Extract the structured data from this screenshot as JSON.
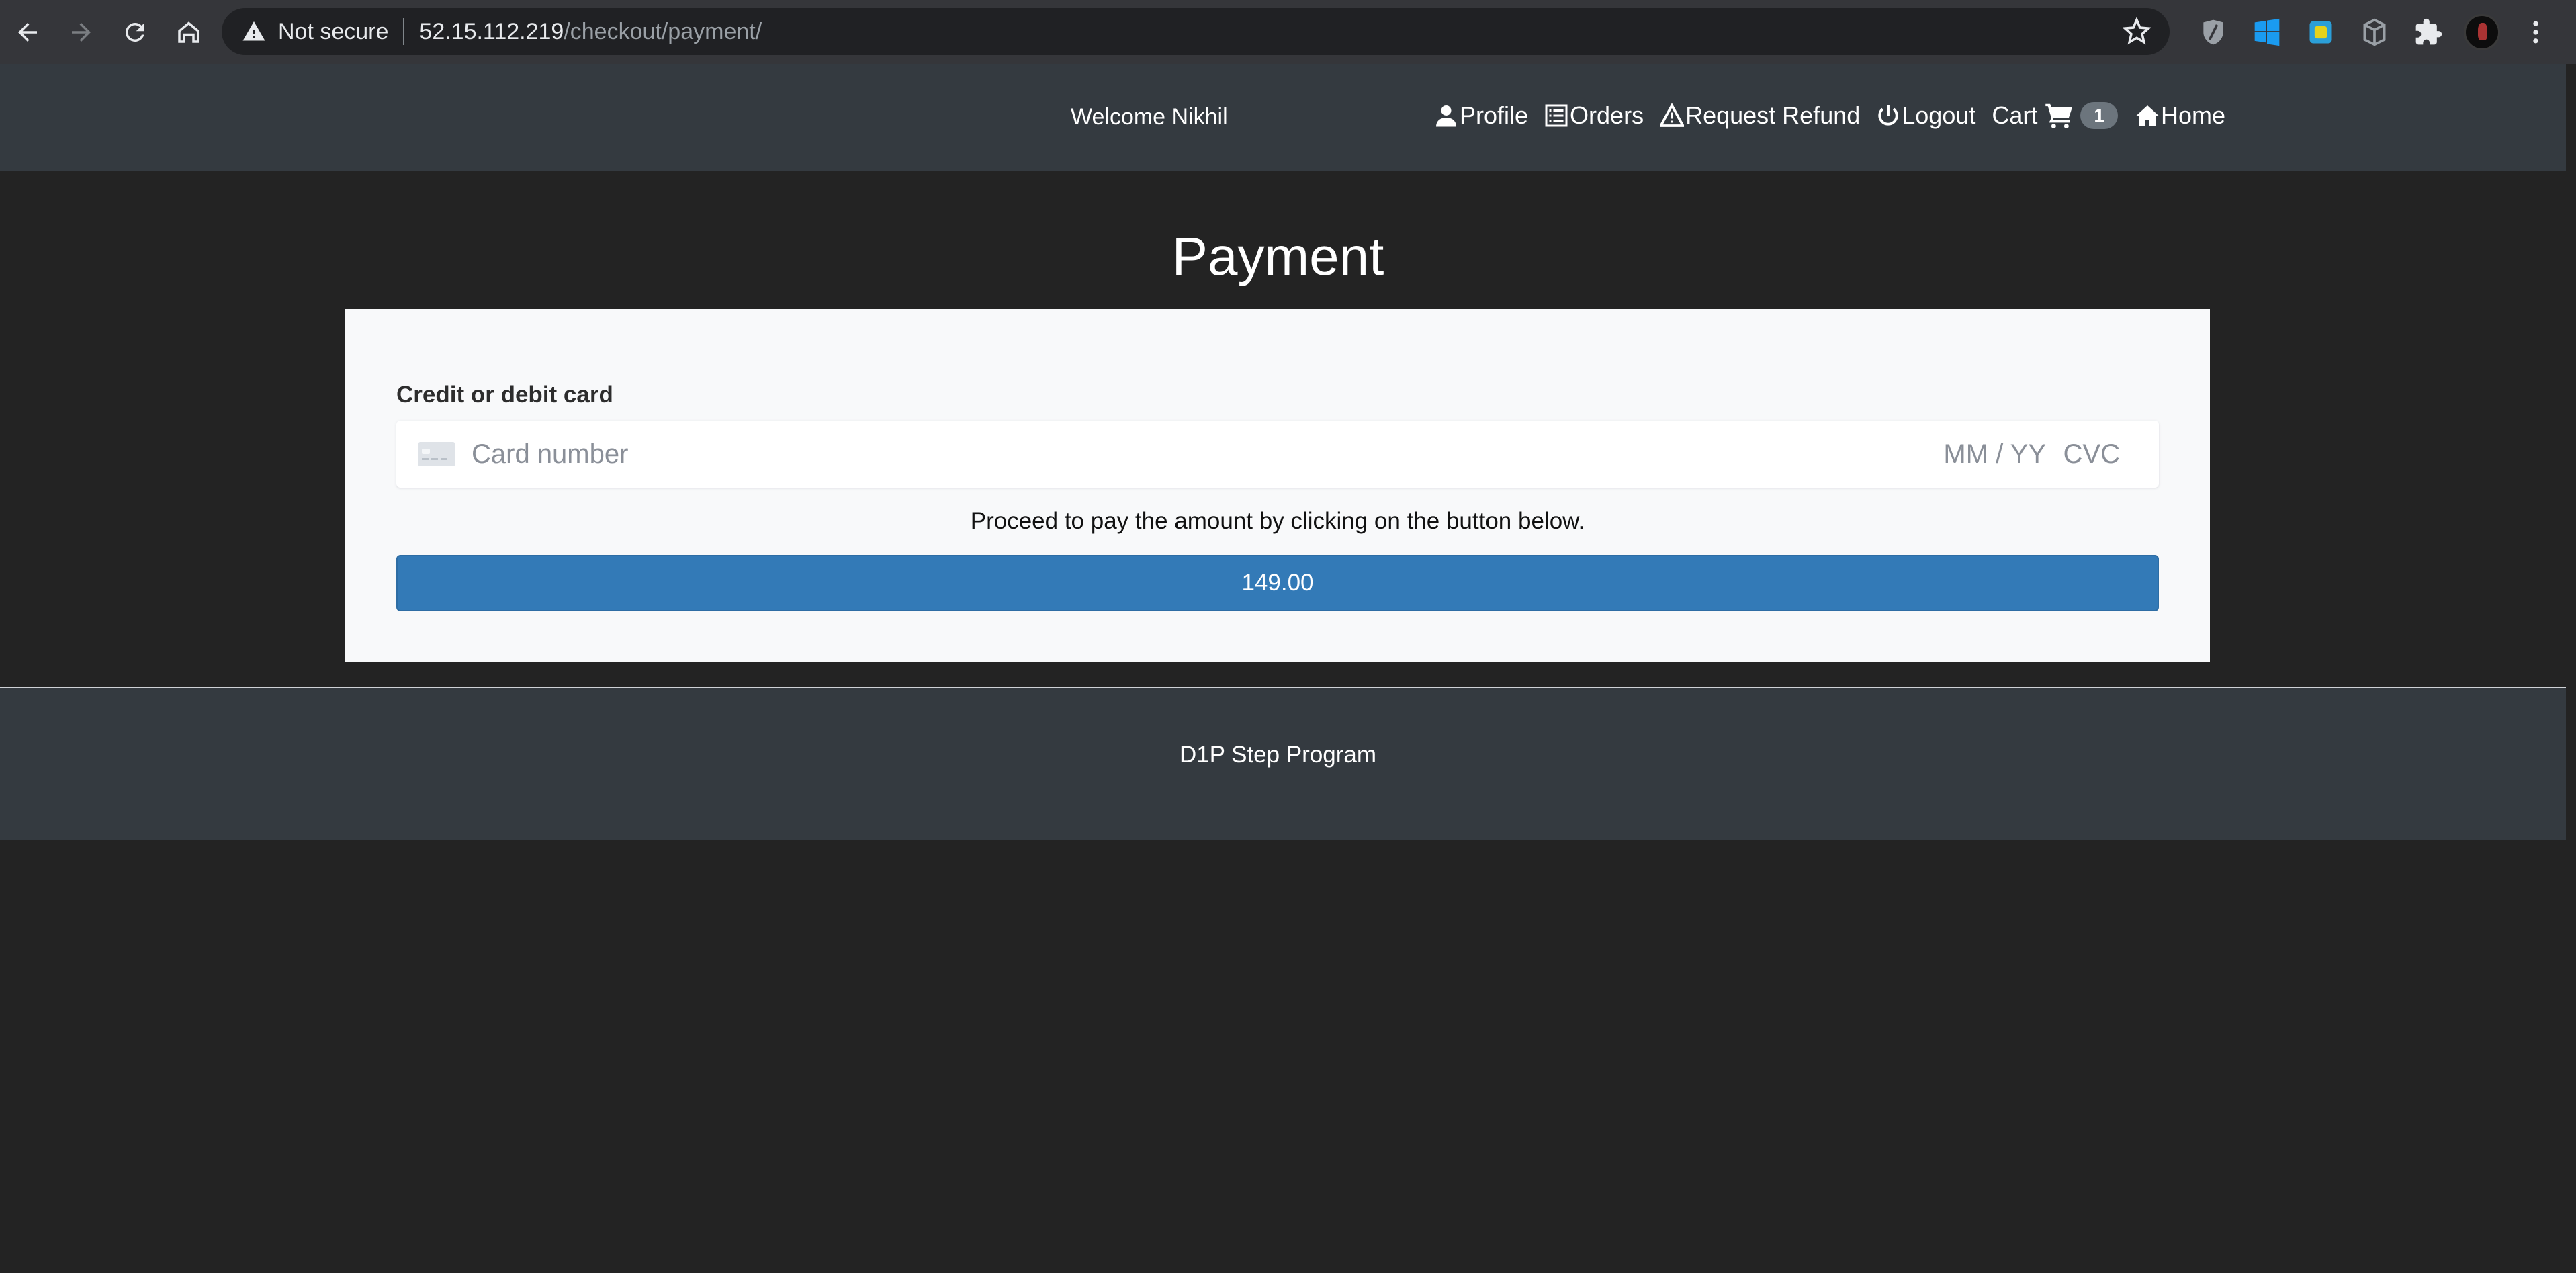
{
  "browser": {
    "security_label": "Not secure",
    "url_host": "52.15.112.219",
    "url_path": "/checkout/payment/"
  },
  "header": {
    "welcome": "Welcome Nikhil",
    "nav": {
      "profile": "Profile",
      "orders": "Orders",
      "refund": "Request Refund",
      "logout": "Logout",
      "cart": "Cart",
      "cart_count": "1",
      "home": "Home"
    }
  },
  "main": {
    "title": "Payment",
    "card_label": "Credit or debit card",
    "card_placeholder": "Card number",
    "expiry_placeholder": "MM / YY",
    "cvc_placeholder": "CVC",
    "instruction": "Proceed to pay the amount by clicking on the button below.",
    "pay_amount": "149.00"
  },
  "footer": {
    "text": "D1P Step Program"
  },
  "colors": {
    "pay_button": "#337ab7",
    "header_bg": "#343a40",
    "page_bg": "#232323"
  }
}
